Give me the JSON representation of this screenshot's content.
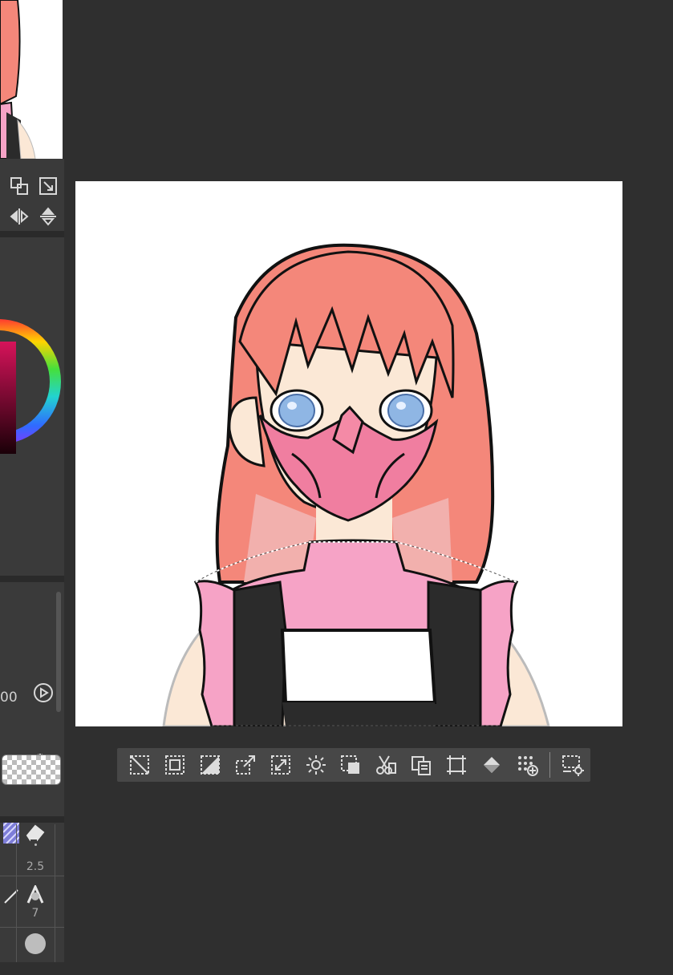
{
  "left_panel": {
    "opacity_value": "00",
    "brush_sizes": [
      "2.5",
      "7"
    ],
    "tools": [
      "move-layer-icon",
      "transform-icon",
      "flip-horizontal-icon",
      "flip-vertical-icon",
      "lasso-icon",
      "magic-wand-icon",
      "tone-pattern-icon",
      "eraser-icon",
      "ruler-icon",
      "text-icon"
    ]
  },
  "canvas": {
    "subject": "illustration",
    "colors": {
      "hair": "#f4877a",
      "mask": "#f07ea0",
      "collar": "#f6a3c6",
      "apron": "#2b2b2b",
      "skin": "#fbe8d6",
      "eyes": "#8fb6e4"
    }
  },
  "selection_toolbar": {
    "buttons": [
      "deselect-icon",
      "invert-selection-icon",
      "clear-outside-icon",
      "transform-selection-icon",
      "scale-selection-icon",
      "expand-selection-icon",
      "shrink-selection-icon",
      "cut-paste-icon",
      "copy-paste-icon",
      "crop-icon",
      "fill-icon",
      "new-tone-layer-icon",
      "selection-settings-icon"
    ]
  }
}
